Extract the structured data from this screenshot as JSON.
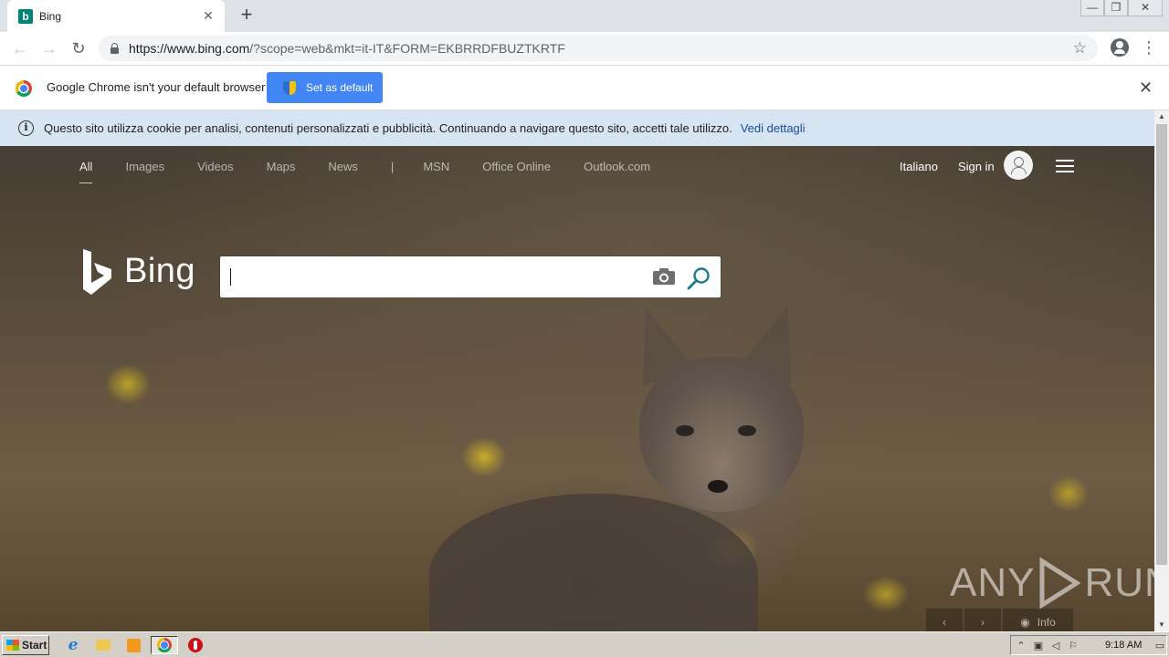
{
  "tab": {
    "title": "Bing",
    "favicon": "b",
    "close": "✕"
  },
  "new_tab": "+",
  "window_controls": {
    "minimize": "—",
    "restore": "❐",
    "close": "✕"
  },
  "toolbar": {
    "back": "←",
    "forward": "→",
    "reload": "↻",
    "url_host": "https://www.bing.com",
    "url_rest": "/?scope=web&mkt=it-IT&FORM=EKBRRDFBUZTKRTF",
    "bookmark": "☆",
    "menu": "⋮"
  },
  "infobar": {
    "message": "Google Chrome isn't your default browser",
    "button": "Set as default",
    "close": "✕"
  },
  "cookie_bar": {
    "icon": "i",
    "message": "Questo sito utilizza cookie per analisi, contenuti personalizzati e pubblicità. Continuando a navigare questo sito, accetti tale utilizzo.",
    "link": "Vedi dettagli"
  },
  "bing": {
    "nav": [
      "All",
      "Images",
      "Videos",
      "Maps",
      "News",
      "|",
      "MSN",
      "Office Online",
      "Outlook.com"
    ],
    "language": "Italiano",
    "sign_in": "Sign in",
    "logo_text": "Bing",
    "search_value": ""
  },
  "watermark": {
    "left": "ANY",
    "right": "RUN"
  },
  "carousel": {
    "prev": "‹",
    "next": "›",
    "info": "Info"
  },
  "scrollbar": {
    "up": "▲",
    "down": "▼"
  },
  "taskbar": {
    "start": "Start",
    "clock": "9:18 AM",
    "ie_glyph": "e"
  },
  "colors": {
    "bing_teal": "#008373",
    "chrome_blue": "#4285f4",
    "cookie_bar": "#d7e4f1",
    "search_icon": "#1a7a8a"
  }
}
